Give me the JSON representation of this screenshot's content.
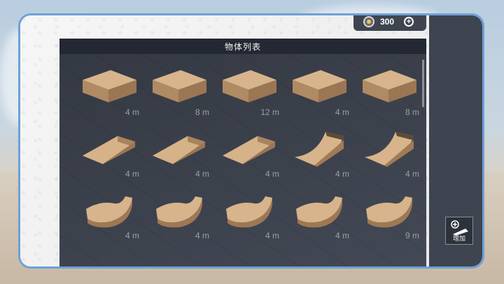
{
  "currency": {
    "amount": "300"
  },
  "panel": {
    "title": "物体列表"
  },
  "items": [
    {
      "shape": "box",
      "length": "4 m"
    },
    {
      "shape": "box",
      "length": "8 m"
    },
    {
      "shape": "box",
      "length": "12 m"
    },
    {
      "shape": "box",
      "length": "4 m"
    },
    {
      "shape": "box",
      "length": "8 m"
    },
    {
      "shape": "wedge",
      "length": "4 m"
    },
    {
      "shape": "wedge",
      "length": "4 m"
    },
    {
      "shape": "wedge",
      "length": "4 m"
    },
    {
      "shape": "quarter-pipe",
      "length": "4 m"
    },
    {
      "shape": "quarter-pipe",
      "length": "4 m"
    },
    {
      "shape": "curve",
      "length": "4 m"
    },
    {
      "shape": "curve",
      "length": "4 m"
    },
    {
      "shape": "curve",
      "length": "4 m"
    },
    {
      "shape": "curve",
      "length": "4 m"
    },
    {
      "shape": "curve",
      "length": "9 m"
    }
  ],
  "add_button": {
    "label": "增加"
  }
}
